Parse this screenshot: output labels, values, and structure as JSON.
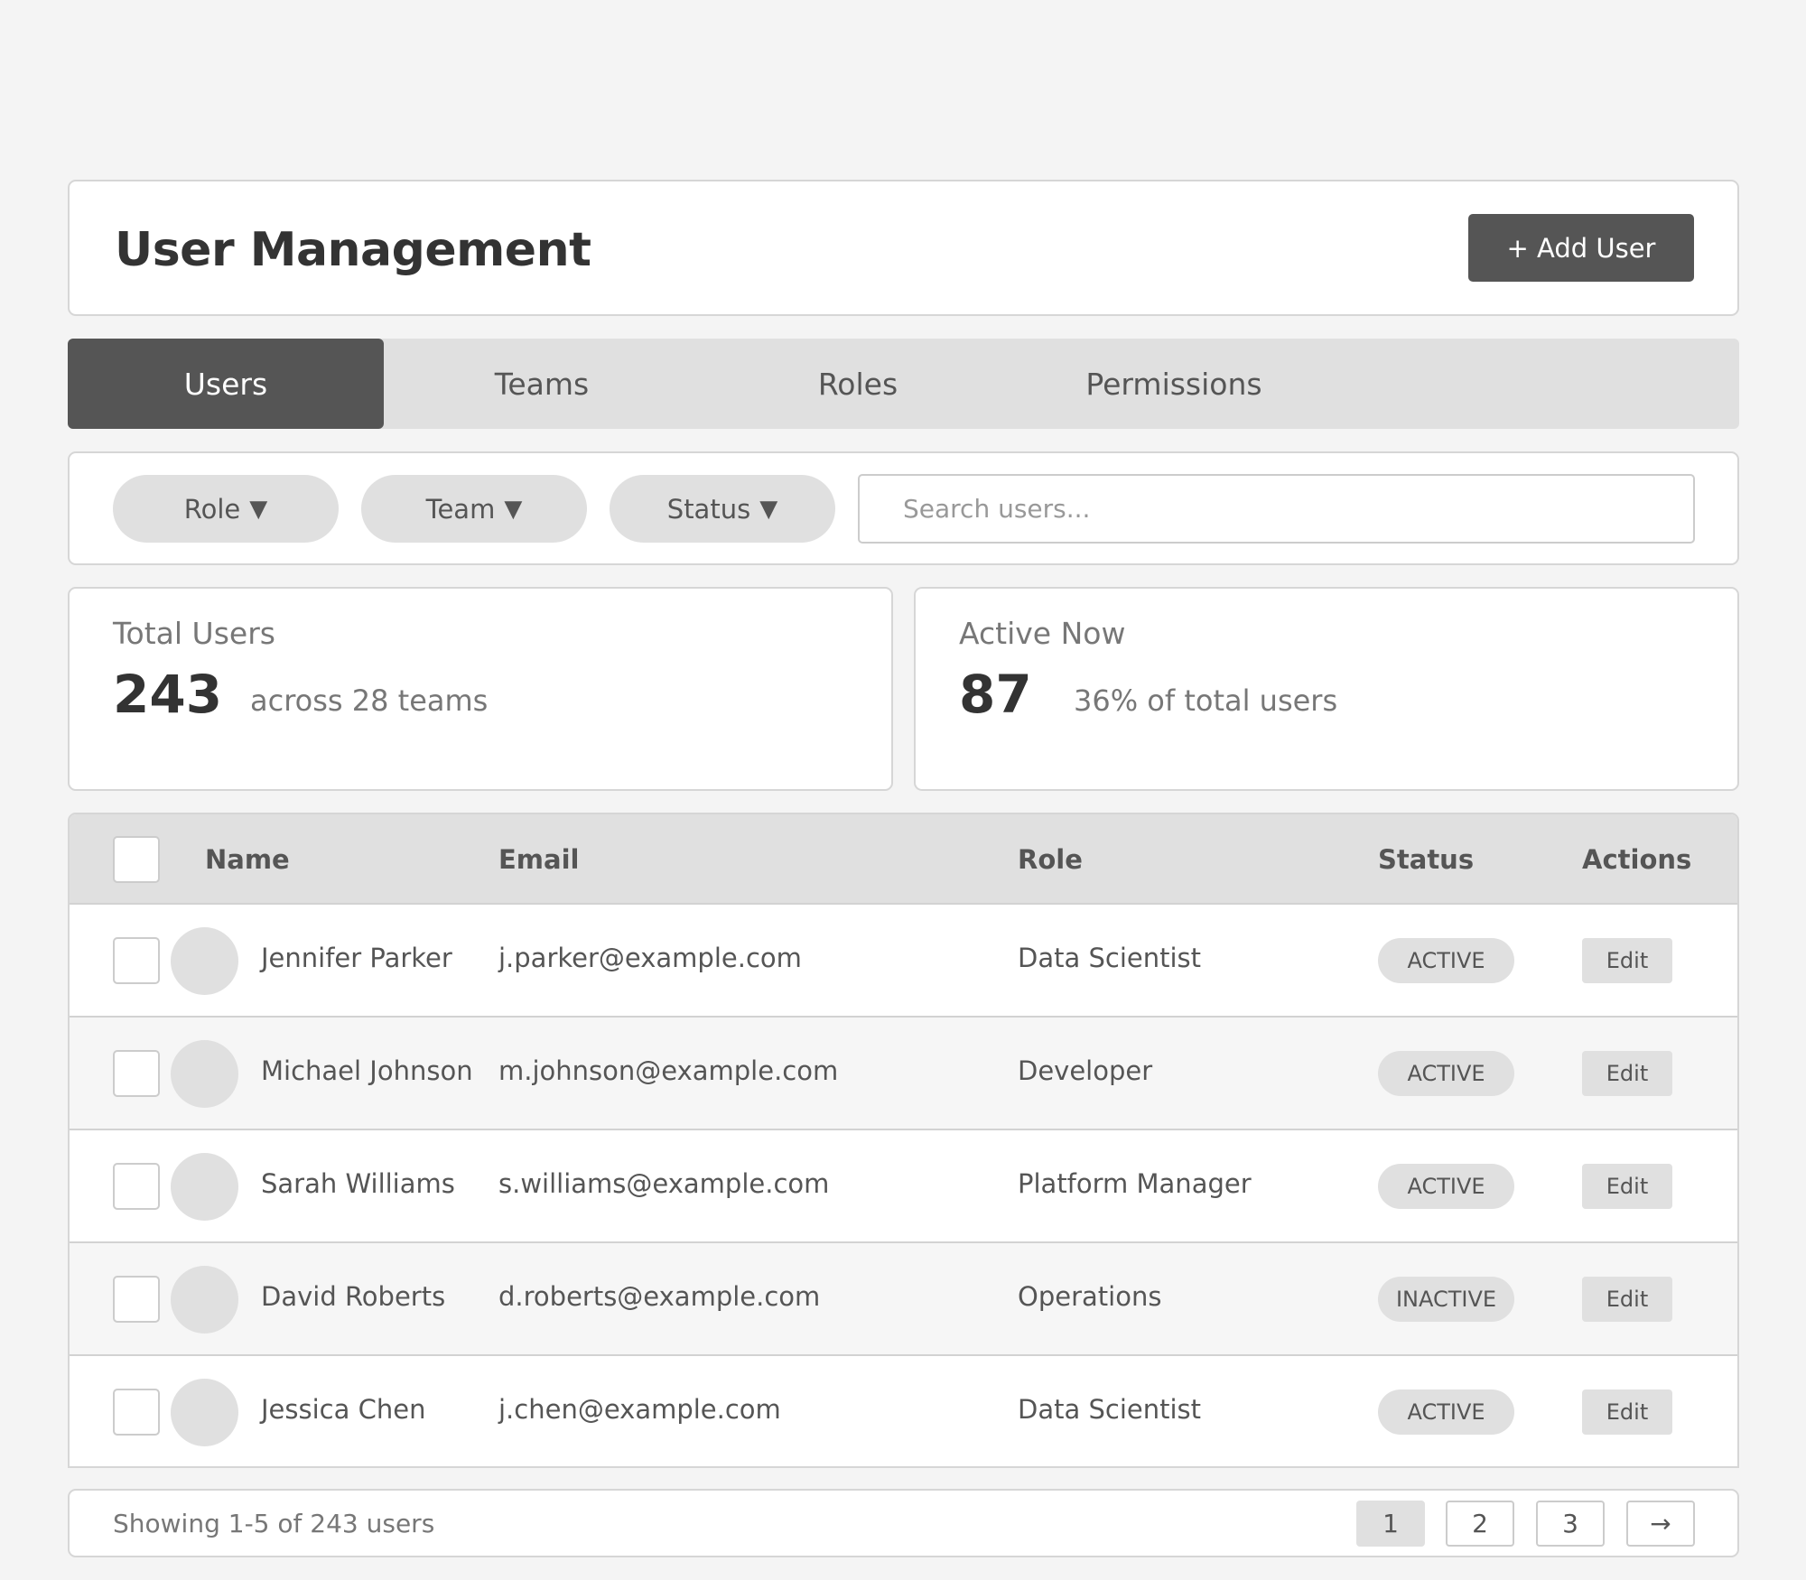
{
  "header": {
    "title": "User Management",
    "add_user_label": "+ Add User"
  },
  "tabs": [
    {
      "label": "Users",
      "active": true
    },
    {
      "label": "Teams",
      "active": false
    },
    {
      "label": "Roles",
      "active": false
    },
    {
      "label": "Permissions",
      "active": false
    }
  ],
  "filters": {
    "role_label": "Role",
    "team_label": "Team",
    "status_label": "Status",
    "caret": "▼",
    "search_placeholder": "Search users...",
    "search_value": ""
  },
  "stats": {
    "total": {
      "label": "Total Users",
      "value": "243",
      "sub": "across 28 teams"
    },
    "active": {
      "label": "Active Now",
      "value": "87",
      "sub": "36% of total users"
    }
  },
  "table": {
    "headers": {
      "name": "Name",
      "email": "Email",
      "role": "Role",
      "status": "Status",
      "actions": "Actions"
    },
    "rows": [
      {
        "name": "Jennifer Parker",
        "email": "j.parker@example.com",
        "role": "Data Scientist",
        "status": "ACTIVE",
        "action": "Edit"
      },
      {
        "name": "Michael Johnson",
        "email": "m.johnson@example.com",
        "role": "Developer",
        "status": "ACTIVE",
        "action": "Edit"
      },
      {
        "name": "Sarah Williams",
        "email": "s.williams@example.com",
        "role": "Platform Manager",
        "status": "ACTIVE",
        "action": "Edit"
      },
      {
        "name": "David Roberts",
        "email": "d.roberts@example.com",
        "role": "Operations",
        "status": "INACTIVE",
        "action": "Edit"
      },
      {
        "name": "Jessica Chen",
        "email": "j.chen@example.com",
        "role": "Data Scientist",
        "status": "ACTIVE",
        "action": "Edit"
      }
    ]
  },
  "pagination": {
    "summary": "Showing 1-5 of 243 users",
    "pages": [
      "1",
      "2",
      "3"
    ],
    "current": "1",
    "next": "→"
  },
  "colors": {
    "background": "#f4f4f4",
    "card": "#ffffff",
    "dark_accent": "#555555",
    "neutral": "#e0e0e0",
    "border": "#d6d6d6"
  }
}
